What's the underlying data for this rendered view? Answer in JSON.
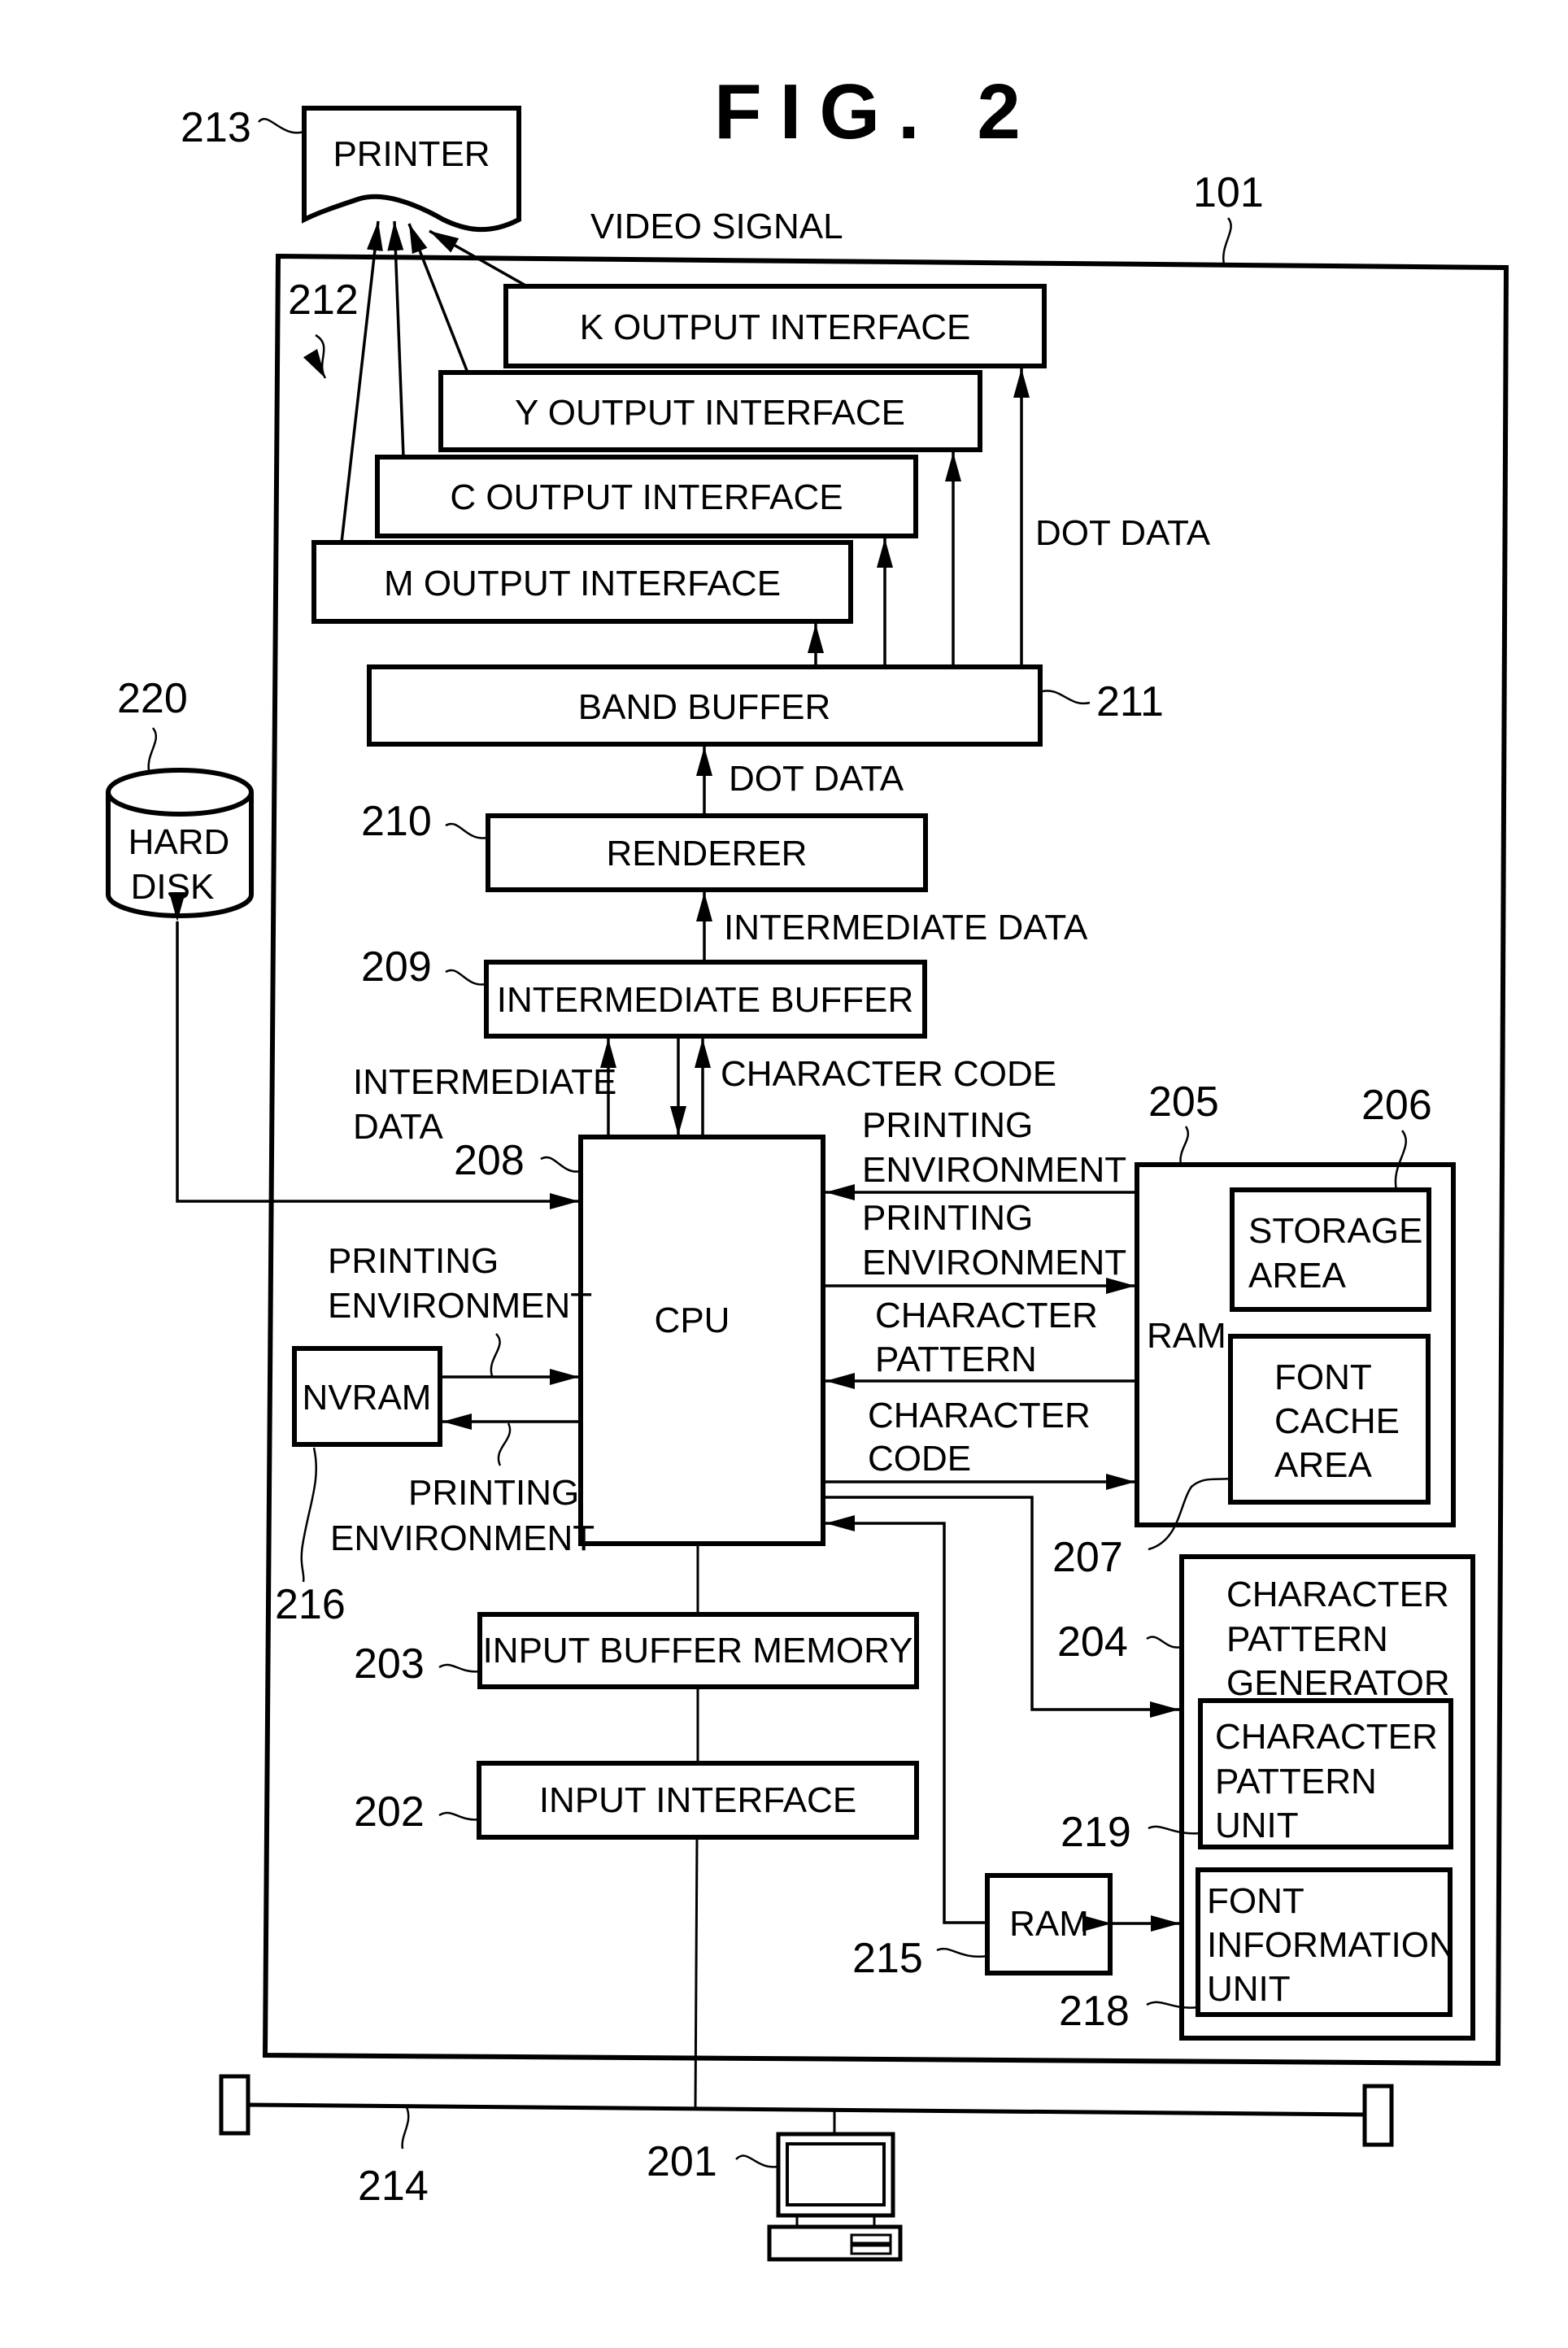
{
  "figure": {
    "title": "FIG. 2",
    "video_signal_label": "VIDEO SIGNAL"
  },
  "refs": {
    "r101": "101",
    "r201": "201",
    "r202": "202",
    "r203": "203",
    "r204": "204",
    "r205": "205",
    "r206": "206",
    "r207": "207",
    "r208": "208",
    "r209": "209",
    "r210": "210",
    "r211": "211",
    "r212": "212",
    "r213": "213",
    "r214": "214",
    "r215": "215",
    "r216": "216",
    "r218": "218",
    "r219": "219",
    "r220": "220"
  },
  "blocks": {
    "printer": "PRINTER",
    "k_output": "K OUTPUT INTERFACE",
    "y_output": "Y OUTPUT INTERFACE",
    "c_output": "C OUTPUT INTERFACE",
    "m_output": "M OUTPUT INTERFACE",
    "band_buffer": "BAND BUFFER",
    "renderer": "RENDERER",
    "intermediate_buffer": "INTERMEDIATE BUFFER",
    "cpu": "CPU",
    "nvram": "NVRAM",
    "hard_disk": [
      "HARD",
      "DISK"
    ],
    "input_buffer_memory": "INPUT BUFFER MEMORY",
    "input_interface": "INPUT INTERFACE",
    "ram_main": "RAM",
    "storage_area": [
      "STORAGE",
      "AREA"
    ],
    "font_cache_area": [
      "FONT",
      "CACHE",
      "AREA"
    ],
    "char_pattern_generator": [
      "CHARACTER",
      "PATTERN",
      "GENERATOR"
    ],
    "char_pattern_unit": [
      "CHARACTER",
      "PATTERN",
      "UNIT"
    ],
    "font_information_unit": [
      "FONT",
      "INFORMATION",
      "UNIT"
    ],
    "ram_sub": "RAM"
  },
  "signals": {
    "dot_data_upper": "DOT DATA",
    "dot_data_lower": "DOT DATA",
    "intermediate_data_right": "INTERMEDIATE DATA",
    "intermediate_data_left": [
      "INTERMEDIATE",
      "DATA"
    ],
    "character_code_top": "CHARACTER CODE",
    "printing_env_from_ram": [
      "PRINTING",
      "ENVIRONMENT"
    ],
    "printing_env_to_ram": [
      "PRINTING",
      "ENVIRONMENT"
    ],
    "character_pattern": [
      "CHARACTER",
      "PATTERN"
    ],
    "character_code_to_ram": [
      "CHARACTER",
      "CODE"
    ],
    "printing_env_to_cpu": [
      "PRINTING",
      "ENVIRONMENT"
    ],
    "printing_env_to_nvram": [
      "PRINTING",
      "ENVIRONMENT"
    ]
  }
}
